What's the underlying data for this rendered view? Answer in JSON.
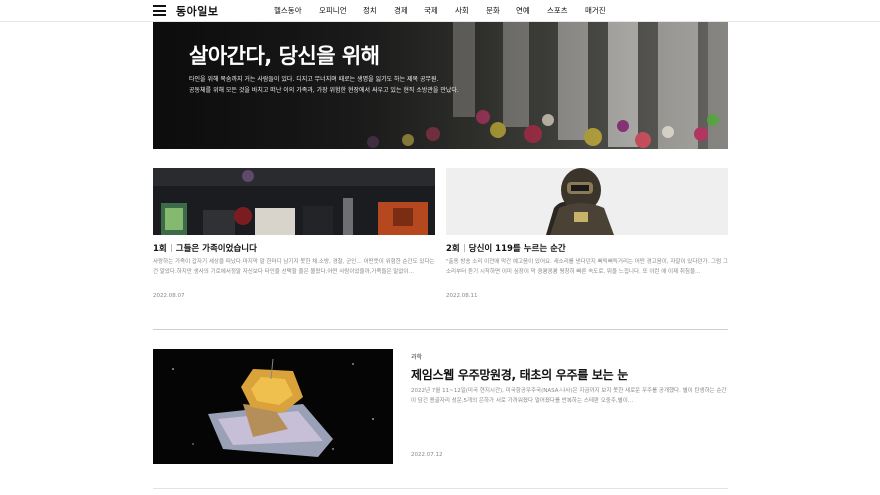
{
  "header": {
    "logo": "동아일보",
    "nav": [
      "헬스동아",
      "오피니언",
      "정치",
      "경제",
      "국제",
      "사회",
      "문화",
      "연예",
      "스포츠",
      "매거진"
    ]
  },
  "hero": {
    "title": "살아간다, 당신을 위해",
    "desc_line1": "타인을 위해 목숨까지 거는 사람들이 있다. 디지고 무너지며 때로는 생명을 잃기도 하는 제복 공무원.",
    "desc_line2": "공동체를 위해 모든 것을 바치고 떠난 이의 가족과, 가장 위험한 현장에서 싸우고 있는 현직 소방관을 만났다."
  },
  "cards": [
    {
      "num": "1회",
      "title": "그들은 가족이었습니다",
      "summary": "사랑하는 가족이 갑자기 세상을 떠났다.마지막 말 한마디 남기지 못한 채.소방, 경찰, 군인… 어떤뜻이 위험한 순간도 있다는 건 알았다.하지만 생사의 기로에서정말 자신보다 타인을 선택할 줄은 몰랐다.어떤 사람이었을까,가족들은 말없이…",
      "date": "2022.08.07"
    },
    {
      "num": "2회",
      "title": "당신이 119를 누르는 순간",
      "summary": "\"출동 방송 소리 이전에 막간 예고음이 있어요. 새소리를 낸다던지 삐릭삐릭거리는 어떤 경고음이, 자잘이 있다던가. 그럼 그 소리부터 듣기 시작하면 이미 심장이 막 쿵쾅쿵쾅 평창히 빠른 속도로, 뛰을 느낍니다. 또 이런 애 이제 취침을…",
      "date": "2022.08.11"
    }
  ],
  "article": {
    "category": "과학",
    "title": "제임스웹 우주망원경, 태초의 우주를 보는 눈",
    "summary": "2022년 7월 11~12일(미국 현지시간), 미국항공우주국(NASA·나사)은 지금까지 보지 못한 새로운 우주를 공개했다. 별이 탄생하는 순간이 담긴 용골자리 성운,5개의 은하가 서로 가까워졌다 멀어졌다를 반복하는 스테판 오중주,별이…",
    "date": "2022.07.12"
  },
  "colors": {
    "text": "#111111",
    "muted": "#888888",
    "divider": "#cfcfcf"
  }
}
